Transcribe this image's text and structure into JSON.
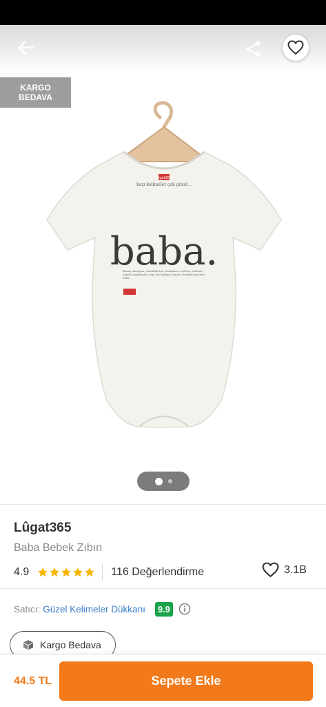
{
  "top_bar": {
    "cargo_tag_line1": "KARGO",
    "cargo_tag_line2": "BEDAVA"
  },
  "gallery": {
    "image_count": 2,
    "active_index": 0,
    "print": {
      "small_label": "lûgat365",
      "tagline": "bazı kelimeler çok güzel…",
      "headline": "baba.",
      "body_text": "Kanat, koruyan, sözüdinleten. Korkusuz, sevilen, özlenen; sürekli yanlarında olan bir babaya benzer, kendini gösterir belli…"
    }
  },
  "product": {
    "brand": "Lûgat365",
    "name": "Baba Bebek Zıbın",
    "rating": "4.9",
    "stars": 5,
    "review_count": "116 Değerlendirme",
    "favorite_count": "3.1B"
  },
  "seller": {
    "label": "Satıcı:",
    "name": "Güzel Kelimeler Dükkanı",
    "score": "9.9"
  },
  "shipping_chip": {
    "label": "Kargo Bedava"
  },
  "footer": {
    "price": "44.5 TL",
    "cta": "Sepete Ekle"
  },
  "colors": {
    "accent": "#f27a1a",
    "star": "#f7b500",
    "seller_score": "#1aa34a",
    "link": "#3a7ec5"
  },
  "icons": [
    "back-arrow-icon",
    "share-icon",
    "heart-icon",
    "star-icon",
    "info-icon",
    "box-icon"
  ]
}
